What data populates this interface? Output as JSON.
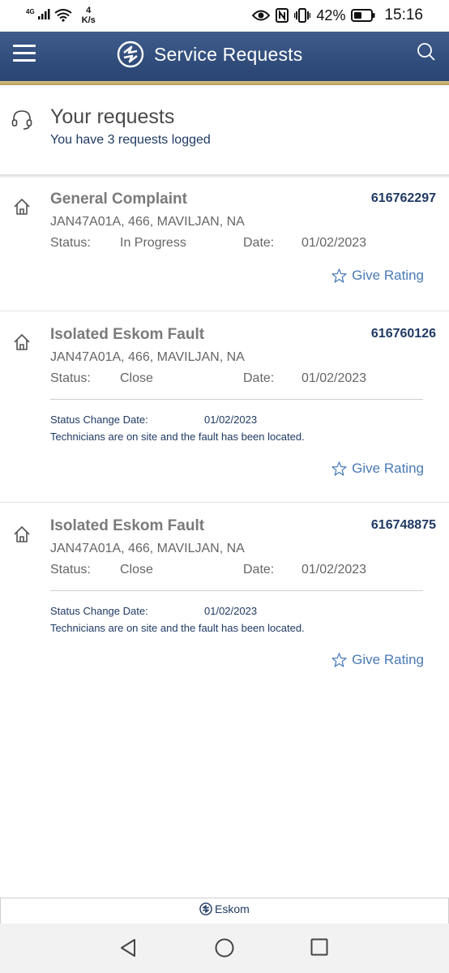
{
  "statusbar": {
    "network": "4G",
    "speed_value": "4",
    "speed_unit": "K/s",
    "battery": "42%",
    "time": "15:16"
  },
  "header": {
    "title": "Service Requests"
  },
  "summary": {
    "title": "Your requests",
    "subtitle": "You have 3 requests logged"
  },
  "labels": {
    "status": "Status:",
    "date": "Date:",
    "status_change_date": "Status Change Date:",
    "give_rating": "Give Rating"
  },
  "requests": [
    {
      "title": "General Complaint",
      "number": "616762297",
      "address": "JAN47A01A, 466, MAVILJAN, NA",
      "status": "In Progress",
      "date": "01/02/2023"
    },
    {
      "title": "Isolated Eskom Fault",
      "number": "616760126",
      "address": "JAN47A01A, 466, MAVILJAN, NA",
      "status": "Close",
      "date": "01/02/2023",
      "status_change_date": "01/02/2023",
      "message": "Technicians are on site and the fault has been located."
    },
    {
      "title": "Isolated Eskom Fault",
      "number": "616748875",
      "address": "JAN47A01A, 466, MAVILJAN, NA",
      "status": "Close",
      "date": "01/02/2023",
      "status_change_date": "01/02/2023",
      "message": "Technicians are on site and the fault has been located."
    }
  ],
  "footer": {
    "brand": "Eskom"
  },
  "colors": {
    "header": "#2e4a78",
    "accent_gold": "#c9b06a",
    "navy_text": "#1f3a64",
    "link_blue": "#4a7ab5"
  }
}
